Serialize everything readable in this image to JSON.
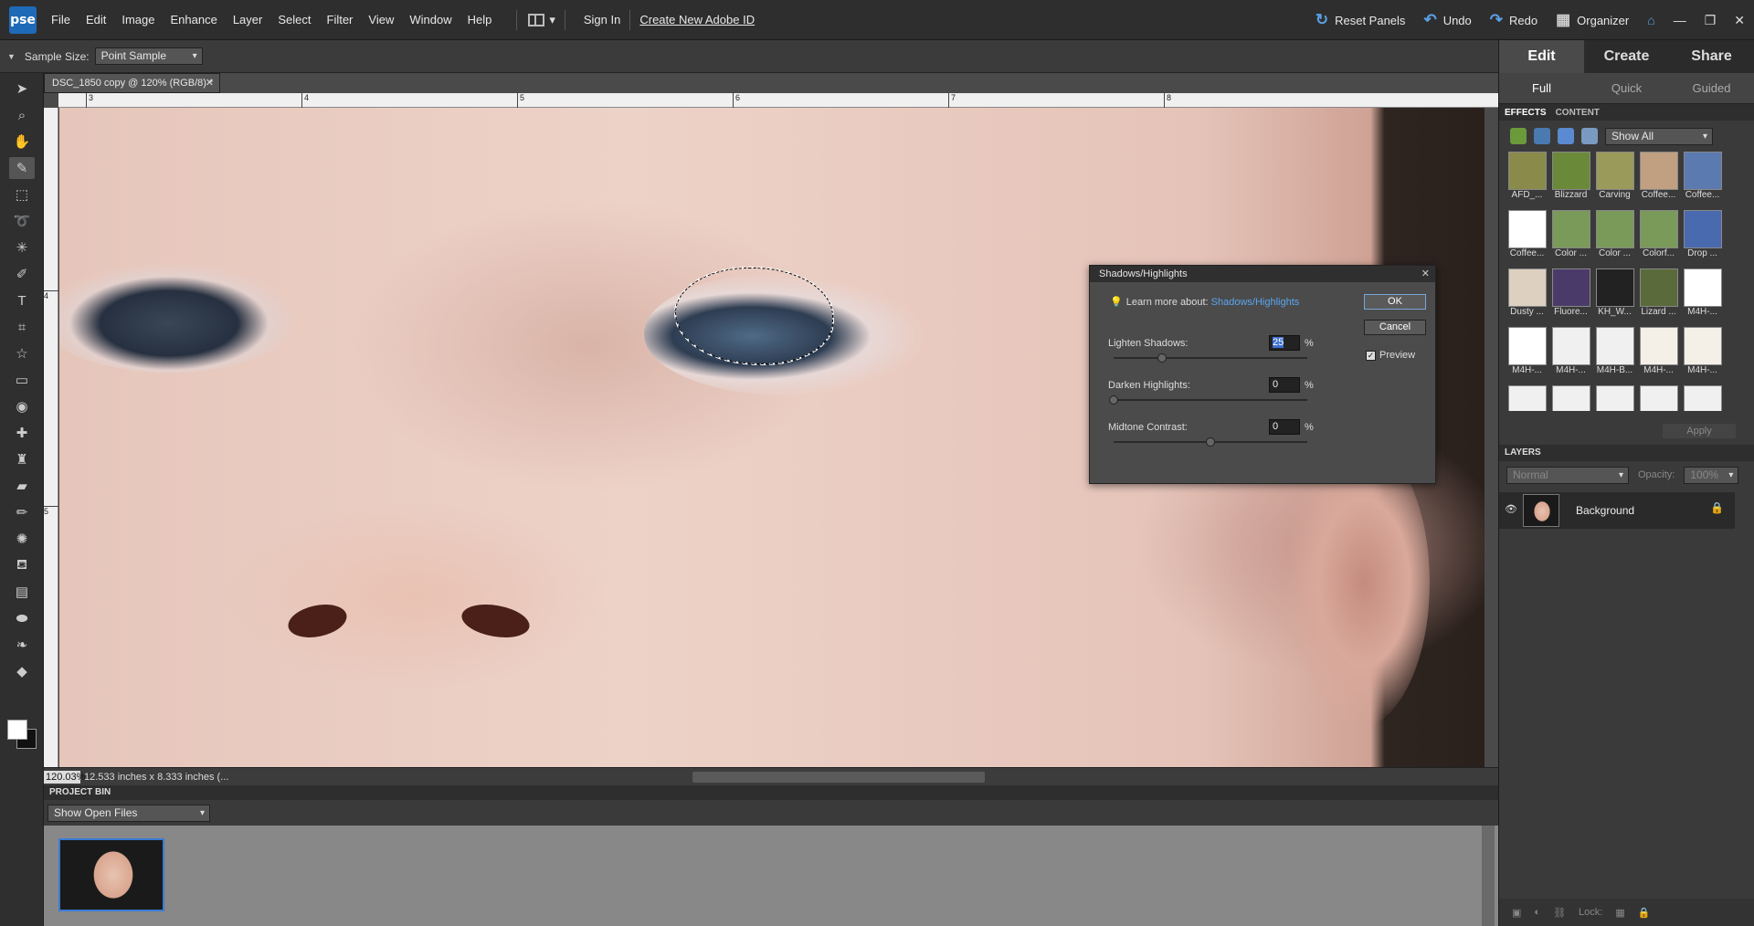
{
  "app": {
    "logo": "pse"
  },
  "menu": [
    "File",
    "Edit",
    "Image",
    "Enhance",
    "Layer",
    "Select",
    "Filter",
    "View",
    "Window",
    "Help"
  ],
  "topbar": {
    "signin": "Sign In",
    "create_id": "Create New Adobe ID",
    "reset": "Reset Panels",
    "undo": "Undo",
    "redo": "Redo",
    "organizer": "Organizer"
  },
  "options": {
    "sample_label": "Sample Size:",
    "sample_value": "Point Sample"
  },
  "document": {
    "tab": "DSC_1850 copy @ 120% (RGB/8) *",
    "zoom": "120.03%",
    "info": "12.533 inches x 8.333 inches (...",
    "ruler_h": [
      "3",
      "4",
      "5",
      "6",
      "7",
      "8"
    ],
    "ruler_v": [
      "4",
      "5"
    ]
  },
  "project_bin": {
    "title": "PROJECT BIN",
    "filter": "Show Open Files"
  },
  "panel": {
    "tabs": [
      "Edit",
      "Create",
      "Share"
    ],
    "subtabs": [
      "Full",
      "Quick",
      "Guided"
    ],
    "effects_tab": "EFFECTS",
    "content_tab": "CONTENT",
    "show": "Show All",
    "apply": "Apply",
    "effects": [
      {
        "label": "AFD_..."
      },
      {
        "label": "Blizzard"
      },
      {
        "label": "Carving"
      },
      {
        "label": "Coffee..."
      },
      {
        "label": "Coffee..."
      },
      {
        "label": "Coffee..."
      },
      {
        "label": "Color ..."
      },
      {
        "label": "Color ..."
      },
      {
        "label": "Colorf..."
      },
      {
        "label": "Drop ..."
      },
      {
        "label": "Dusty ..."
      },
      {
        "label": "Fluore..."
      },
      {
        "label": "KH_W..."
      },
      {
        "label": "Lizard ..."
      },
      {
        "label": "M4H-..."
      },
      {
        "label": "M4H-..."
      },
      {
        "label": "M4H-..."
      },
      {
        "label": "M4H-B..."
      },
      {
        "label": "M4H-..."
      },
      {
        "label": "M4H-..."
      },
      {
        "label": ""
      },
      {
        "label": ""
      },
      {
        "label": ""
      },
      {
        "label": ""
      },
      {
        "label": ""
      }
    ],
    "layers_title": "LAYERS",
    "blend": "Normal",
    "opacity_label": "Opacity:",
    "opacity": "100%",
    "layer_name": "Background",
    "lock_label": "Lock:"
  },
  "dialog": {
    "title": "Shadows/Highlights",
    "learn_prefix": "Learn more about:",
    "learn_link": "Shadows/Highlights",
    "ok": "OK",
    "cancel": "Cancel",
    "preview": "Preview",
    "sliders": [
      {
        "label": "Lighten Shadows:",
        "value": "25",
        "unit": "%",
        "fraction": 0.25
      },
      {
        "label": "Darken Highlights:",
        "value": "0",
        "unit": "%",
        "fraction": 0.0
      },
      {
        "label": "Midtone Contrast:",
        "value": "0",
        "unit": "%",
        "fraction": 0.5
      }
    ]
  }
}
